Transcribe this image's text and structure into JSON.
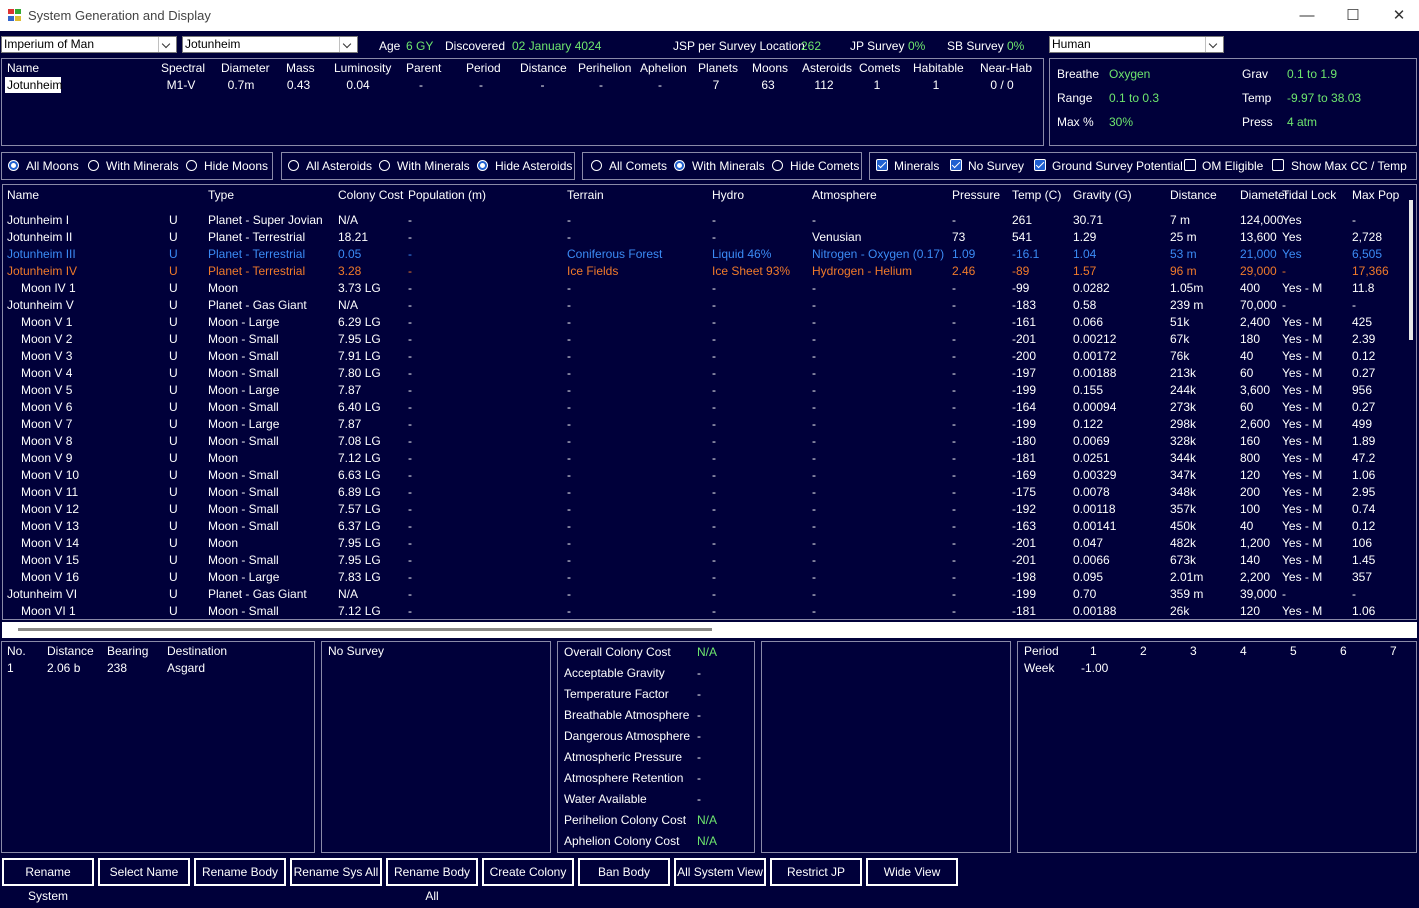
{
  "window": {
    "title": "System Generation and Display",
    "minimize": "—",
    "maximize": "☐",
    "close": "✕"
  },
  "top": {
    "empire": "Imperium of Man",
    "system": "Jotunheim",
    "age_label": "Age",
    "age_value": "6 GY",
    "discovered_label": "Discovered",
    "discovered_value": "02 January 4024",
    "jsp_label": "JSP per Survey Location",
    "jsp_value": "262",
    "jp_label": "JP Survey",
    "jp_value": "0%",
    "sb_label": "SB Survey",
    "sb_value": "0%",
    "species": "Human"
  },
  "star": {
    "headers": [
      "Name",
      "Spectral",
      "Diameter",
      "Mass",
      "Luminosity",
      "Parent",
      "Period",
      "Distance",
      "Perihelion",
      "Aphelion",
      "Planets",
      "Moons",
      "Asteroids",
      "Comets",
      "Habitable",
      "Near-Hab"
    ],
    "values": [
      "Jotunheim",
      "M1-V",
      "0.7m",
      "0.43",
      "0.04",
      "-",
      "-",
      "-",
      "-",
      "-",
      "7",
      "63",
      "112",
      "1",
      "1",
      "0 / 0"
    ]
  },
  "species_panel": {
    "breathe_label": "Breathe",
    "breathe_value": "Oxygen",
    "grav_label": "Grav",
    "grav_value": "0.1  to  1.9",
    "range_label": "Range",
    "range_value": "0.1  to  0.3",
    "temp_label": "Temp",
    "temp_value": "-9.97  to  38.03",
    "max_label": "Max %",
    "max_value": "30%",
    "press_label": "Press",
    "press_value": "4 atm"
  },
  "filters": {
    "moons": [
      "All Moons",
      "With Minerals",
      "Hide Moons"
    ],
    "asteroids": [
      "All Asteroids",
      "With Minerals",
      "Hide Asteroids"
    ],
    "comets": [
      "All Comets",
      "With Minerals",
      "Hide Comets"
    ],
    "checks": [
      "Minerals",
      "No Survey",
      "Ground Survey Potential",
      "OM Eligible",
      "Show Max CC / Temp"
    ]
  },
  "table": {
    "headers": [
      "Name",
      "Type",
      "Colony Cost",
      "Population (m)",
      "Terrain",
      "Hydro",
      "Atmosphere",
      "Pressure",
      "Temp (C)",
      "Gravity (G)",
      "Distance",
      "Diameter",
      "Tidal Lock",
      "Max Pop"
    ],
    "rows": [
      {
        "name": "Jotunheim I",
        "u": "U",
        "type": "Planet - Super Jovian",
        "cc": "N/A",
        "pop": "-",
        "terrain": "-",
        "hydro": "-",
        "atmo": "-",
        "press": "-",
        "temp": "261",
        "grav": "30.71",
        "dist": "7 m",
        "diam": "124,000",
        "tidal": "Yes",
        "maxpop": "-",
        "style": "",
        "indent": false
      },
      {
        "name": "Jotunheim II",
        "u": "U",
        "type": "Planet - Terrestrial",
        "cc": "18.21",
        "pop": "-",
        "terrain": "-",
        "hydro": "-",
        "atmo": "Venusian",
        "press": "73",
        "temp": "541",
        "grav": "1.29",
        "dist": "25 m",
        "diam": "13,600",
        "tidal": "Yes",
        "maxpop": "2,728",
        "style": "",
        "indent": false
      },
      {
        "name": "Jotunheim III",
        "u": "U",
        "type": "Planet - Terrestrial",
        "cc": "0.05",
        "pop": "-",
        "terrain": "Coniferous Forest",
        "hydro": "Liquid 46%",
        "atmo": "Nitrogen - Oxygen (0.17)",
        "press": "1.09",
        "temp": "-16.1",
        "grav": "1.04",
        "dist": "53 m",
        "diam": "21,000",
        "tidal": "Yes",
        "maxpop": "6,505",
        "style": "blue",
        "indent": false
      },
      {
        "name": "Jotunheim IV",
        "u": "U",
        "type": "Planet - Terrestrial",
        "cc": "3.28",
        "pop": "-",
        "terrain": "Ice Fields",
        "hydro": "Ice Sheet 93%",
        "atmo": "Hydrogen - Helium",
        "press": "2.46",
        "temp": "-89",
        "grav": "1.57",
        "dist": "96 m",
        "diam": "29,000",
        "tidal": "-",
        "maxpop": "17,366",
        "style": "orange",
        "indent": false
      },
      {
        "name": "Moon IV 1",
        "u": "U",
        "type": "Moon",
        "cc": "3.73 LG",
        "pop": "-",
        "terrain": "-",
        "hydro": "-",
        "atmo": "-",
        "press": "-",
        "temp": "-99",
        "grav": "0.0282",
        "dist": "1.05m",
        "diam": "400",
        "tidal": "Yes - M",
        "maxpop": "11.8",
        "style": "",
        "indent": true
      },
      {
        "name": "Jotunheim V",
        "u": "U",
        "type": "Planet - Gas Giant",
        "cc": "N/A",
        "pop": "-",
        "terrain": "-",
        "hydro": "-",
        "atmo": "-",
        "press": "-",
        "temp": "-183",
        "grav": "0.58",
        "dist": "239 m",
        "diam": "70,000",
        "tidal": "-",
        "maxpop": "-",
        "style": "",
        "indent": false
      },
      {
        "name": "Moon V 1",
        "u": "U",
        "type": "Moon - Large",
        "cc": "6.29 LG",
        "pop": "-",
        "terrain": "-",
        "hydro": "-",
        "atmo": "-",
        "press": "-",
        "temp": "-161",
        "grav": "0.066",
        "dist": "51k",
        "diam": "2,400",
        "tidal": "Yes - M",
        "maxpop": "425",
        "style": "",
        "indent": true
      },
      {
        "name": "Moon V 2",
        "u": "U",
        "type": "Moon - Small",
        "cc": "7.95 LG",
        "pop": "-",
        "terrain": "-",
        "hydro": "-",
        "atmo": "-",
        "press": "-",
        "temp": "-201",
        "grav": "0.00212",
        "dist": "67k",
        "diam": "180",
        "tidal": "Yes - M",
        "maxpop": "2.39",
        "style": "",
        "indent": true
      },
      {
        "name": "Moon V 3",
        "u": "U",
        "type": "Moon - Small",
        "cc": "7.91 LG",
        "pop": "-",
        "terrain": "-",
        "hydro": "-",
        "atmo": "-",
        "press": "-",
        "temp": "-200",
        "grav": "0.00172",
        "dist": "76k",
        "diam": "40",
        "tidal": "Yes - M",
        "maxpop": "0.12",
        "style": "",
        "indent": true
      },
      {
        "name": "Moon V 4",
        "u": "U",
        "type": "Moon - Small",
        "cc": "7.80 LG",
        "pop": "-",
        "terrain": "-",
        "hydro": "-",
        "atmo": "-",
        "press": "-",
        "temp": "-197",
        "grav": "0.00188",
        "dist": "213k",
        "diam": "60",
        "tidal": "Yes - M",
        "maxpop": "0.27",
        "style": "",
        "indent": true
      },
      {
        "name": "Moon V 5",
        "u": "U",
        "type": "Moon - Large",
        "cc": "7.87",
        "pop": "-",
        "terrain": "-",
        "hydro": "-",
        "atmo": "-",
        "press": "-",
        "temp": "-199",
        "grav": "0.155",
        "dist": "244k",
        "diam": "3,600",
        "tidal": "Yes - M",
        "maxpop": "956",
        "style": "",
        "indent": true
      },
      {
        "name": "Moon V 6",
        "u": "U",
        "type": "Moon - Small",
        "cc": "6.40 LG",
        "pop": "-",
        "terrain": "-",
        "hydro": "-",
        "atmo": "-",
        "press": "-",
        "temp": "-164",
        "grav": "0.00094",
        "dist": "273k",
        "diam": "60",
        "tidal": "Yes - M",
        "maxpop": "0.27",
        "style": "",
        "indent": true
      },
      {
        "name": "Moon V 7",
        "u": "U",
        "type": "Moon - Large",
        "cc": "7.87",
        "pop": "-",
        "terrain": "-",
        "hydro": "-",
        "atmo": "-",
        "press": "-",
        "temp": "-199",
        "grav": "0.122",
        "dist": "298k",
        "diam": "2,600",
        "tidal": "Yes - M",
        "maxpop": "499",
        "style": "",
        "indent": true
      },
      {
        "name": "Moon V 8",
        "u": "U",
        "type": "Moon - Small",
        "cc": "7.08 LG",
        "pop": "-",
        "terrain": "-",
        "hydro": "-",
        "atmo": "-",
        "press": "-",
        "temp": "-180",
        "grav": "0.0069",
        "dist": "328k",
        "diam": "160",
        "tidal": "Yes - M",
        "maxpop": "1.89",
        "style": "",
        "indent": true
      },
      {
        "name": "Moon V 9",
        "u": "U",
        "type": "Moon",
        "cc": "7.12 LG",
        "pop": "-",
        "terrain": "-",
        "hydro": "-",
        "atmo": "-",
        "press": "-",
        "temp": "-181",
        "grav": "0.0251",
        "dist": "344k",
        "diam": "800",
        "tidal": "Yes - M",
        "maxpop": "47.2",
        "style": "",
        "indent": true
      },
      {
        "name": "Moon V 10",
        "u": "U",
        "type": "Moon - Small",
        "cc": "6.63 LG",
        "pop": "-",
        "terrain": "-",
        "hydro": "-",
        "atmo": "-",
        "press": "-",
        "temp": "-169",
        "grav": "0.00329",
        "dist": "347k",
        "diam": "120",
        "tidal": "Yes - M",
        "maxpop": "1.06",
        "style": "",
        "indent": true
      },
      {
        "name": "Moon V 11",
        "u": "U",
        "type": "Moon - Small",
        "cc": "6.89 LG",
        "pop": "-",
        "terrain": "-",
        "hydro": "-",
        "atmo": "-",
        "press": "-",
        "temp": "-175",
        "grav": "0.0078",
        "dist": "348k",
        "diam": "200",
        "tidal": "Yes - M",
        "maxpop": "2.95",
        "style": "",
        "indent": true
      },
      {
        "name": "Moon V 12",
        "u": "U",
        "type": "Moon - Small",
        "cc": "7.57 LG",
        "pop": "-",
        "terrain": "-",
        "hydro": "-",
        "atmo": "-",
        "press": "-",
        "temp": "-192",
        "grav": "0.00118",
        "dist": "357k",
        "diam": "100",
        "tidal": "Yes - M",
        "maxpop": "0.74",
        "style": "",
        "indent": true
      },
      {
        "name": "Moon V 13",
        "u": "U",
        "type": "Moon - Small",
        "cc": "6.37 LG",
        "pop": "-",
        "terrain": "-",
        "hydro": "-",
        "atmo": "-",
        "press": "-",
        "temp": "-163",
        "grav": "0.00141",
        "dist": "450k",
        "diam": "40",
        "tidal": "Yes - M",
        "maxpop": "0.12",
        "style": "",
        "indent": true
      },
      {
        "name": "Moon V 14",
        "u": "U",
        "type": "Moon",
        "cc": "7.95 LG",
        "pop": "-",
        "terrain": "-",
        "hydro": "-",
        "atmo": "-",
        "press": "-",
        "temp": "-201",
        "grav": "0.047",
        "dist": "482k",
        "diam": "1,200",
        "tidal": "Yes - M",
        "maxpop": "106",
        "style": "",
        "indent": true
      },
      {
        "name": "Moon V 15",
        "u": "U",
        "type": "Moon - Small",
        "cc": "7.95 LG",
        "pop": "-",
        "terrain": "-",
        "hydro": "-",
        "atmo": "-",
        "press": "-",
        "temp": "-201",
        "grav": "0.0066",
        "dist": "673k",
        "diam": "140",
        "tidal": "Yes - M",
        "maxpop": "1.45",
        "style": "",
        "indent": true
      },
      {
        "name": "Moon V 16",
        "u": "U",
        "type": "Moon - Large",
        "cc": "7.83 LG",
        "pop": "-",
        "terrain": "-",
        "hydro": "-",
        "atmo": "-",
        "press": "-",
        "temp": "-198",
        "grav": "0.095",
        "dist": "2.01m",
        "diam": "2,200",
        "tidal": "Yes - M",
        "maxpop": "357",
        "style": "",
        "indent": true
      },
      {
        "name": "Jotunheim VI",
        "u": "U",
        "type": "Planet - Gas Giant",
        "cc": "N/A",
        "pop": "-",
        "terrain": "-",
        "hydro": "-",
        "atmo": "-",
        "press": "-",
        "temp": "-199",
        "grav": "0.70",
        "dist": "359 m",
        "diam": "39,000",
        "tidal": "-",
        "maxpop": "-",
        "style": "",
        "indent": false
      },
      {
        "name": "Moon VI 1",
        "u": "U",
        "type": "Moon - Small",
        "cc": "7.12 LG",
        "pop": "-",
        "terrain": "-",
        "hydro": "-",
        "atmo": "-",
        "press": "-",
        "temp": "-181",
        "grav": "0.00188",
        "dist": "26k",
        "diam": "120",
        "tidal": "Yes - M",
        "maxpop": "1.06",
        "style": "",
        "indent": true
      }
    ]
  },
  "jump_points": {
    "headers": [
      "No.",
      "Distance",
      "Bearing",
      "Destination"
    ],
    "rows": [
      [
        "1",
        "2.06 b",
        "238",
        "Asgard"
      ]
    ]
  },
  "survey_panel": {
    "text": "No Survey"
  },
  "colony_cost": {
    "items": [
      {
        "label": "Overall Colony Cost",
        "value": "N/A"
      },
      {
        "label": "Acceptable Gravity",
        "value": "-"
      },
      {
        "label": "Temperature Factor",
        "value": "-"
      },
      {
        "label": "Breathable Atmosphere",
        "value": "-"
      },
      {
        "label": "Dangerous Atmosphere",
        "value": "-"
      },
      {
        "label": "Atmospheric Pressure",
        "value": "-"
      },
      {
        "label": "Atmosphere Retention",
        "value": "-"
      },
      {
        "label": "Water Available",
        "value": "-"
      },
      {
        "label": "Perihelion Colony Cost",
        "value": "N/A"
      },
      {
        "label": "Aphelion Colony Cost",
        "value": "N/A"
      }
    ]
  },
  "period_panel": {
    "period_label": "Period",
    "periods": [
      "1",
      "2",
      "3",
      "4",
      "5",
      "6",
      "7"
    ],
    "week_label": "Week",
    "week_value": "-1.00"
  },
  "buttons": [
    "Rename System",
    "Select Name",
    "Rename Body",
    "Rename Sys All",
    "Rename Body All",
    "Create Colony",
    "Ban Body",
    "All System View",
    "Restrict JP",
    "Wide View"
  ],
  "colors": {
    "background": "#00003a",
    "value_green": "#6ee66e",
    "highlight_blue": "#3b8bf5",
    "highlight_orange": "#f07a2a"
  }
}
